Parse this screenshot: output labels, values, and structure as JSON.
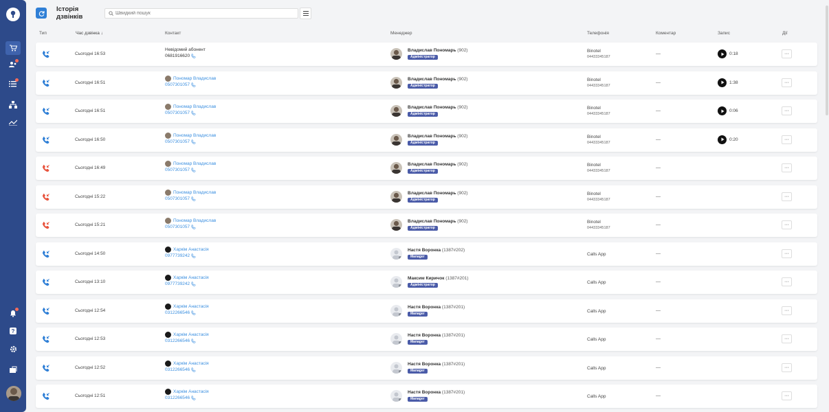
{
  "colors": {
    "accent": "#2f7fd6",
    "sidebar": "#2d4a8a",
    "incoming": "#2f7fd6",
    "missed": "#e8543e",
    "link": "#3b8fe0",
    "role_badge": "#4a5ba8"
  },
  "header": {
    "title": "Історія дзвінків",
    "search_placeholder": "Швидкий пошук"
  },
  "sidebar": {
    "icons": [
      "cart-icon",
      "users-icon",
      "tasks-icon",
      "structure-icon",
      "analytics-icon",
      "notifications-icon",
      "help-icon",
      "settings-icon",
      "exit-icon"
    ]
  },
  "columns": {
    "type": "Тип",
    "time": "Час дзвінка ↓",
    "contact": "Контакт",
    "manager": "Менеджер",
    "telephony": "Телефонія",
    "comment": "Коментар",
    "record": "Запис",
    "actions": "Дії"
  },
  "rows": [
    {
      "status": "incoming",
      "time": "Сьогодні 16:53",
      "contact_name": "Невідомий абонент",
      "contact_known": false,
      "contact_avatar": "none",
      "contact_phone": "0681916620",
      "manager": "Владислав Пономарь",
      "manager_ext": "(902)",
      "role": "Адміністратор",
      "manager_avatar": "photo",
      "telephony": "Binotel",
      "tel_number": "04433345187",
      "comment": "—",
      "record": "0:18"
    },
    {
      "status": "incoming",
      "time": "Сьогодні 16:51",
      "contact_name": "Пономар Владислав",
      "contact_known": true,
      "contact_avatar": "photo",
      "contact_phone": "0507301057",
      "manager": "Владислав Пономарь",
      "manager_ext": "(902)",
      "role": "Адміністратор",
      "manager_avatar": "photo",
      "telephony": "Binotel",
      "tel_number": "04433345187",
      "comment": "—",
      "record": "1:38"
    },
    {
      "status": "incoming",
      "time": "Сьогодні 16:51",
      "contact_name": "Пономар Владислав",
      "contact_known": true,
      "contact_avatar": "photo",
      "contact_phone": "0507301057",
      "manager": "Владислав Пономарь",
      "manager_ext": "(902)",
      "role": "Адміністратор",
      "manager_avatar": "photo",
      "telephony": "Binotel",
      "tel_number": "04433345187",
      "comment": "—",
      "record": "0:06"
    },
    {
      "status": "incoming",
      "time": "Сьогодні 16:50",
      "contact_name": "Пономар Владислав",
      "contact_known": true,
      "contact_avatar": "photo",
      "contact_phone": "0507301057",
      "manager": "Владислав Пономарь",
      "manager_ext": "(902)",
      "role": "Адміністратор",
      "manager_avatar": "photo",
      "telephony": "Binotel",
      "tel_number": "04433345187",
      "comment": "—",
      "record": "0:20"
    },
    {
      "status": "missed",
      "time": "Сьогодні 16:49",
      "contact_name": "Пономар Владислав",
      "contact_known": true,
      "contact_avatar": "photo",
      "contact_phone": "0507301057",
      "manager": "Владислав Пономарь",
      "manager_ext": "(902)",
      "role": "Адміністратор",
      "manager_avatar": "photo",
      "telephony": "Binotel",
      "tel_number": "04433345187",
      "comment": "—",
      "record": ""
    },
    {
      "status": "missed",
      "time": "Сьогодні 15:22",
      "contact_name": "Пономар Владислав",
      "contact_known": true,
      "contact_avatar": "photo",
      "contact_phone": "0507301057",
      "manager": "Владислав Пономарь",
      "manager_ext": "(902)",
      "role": "Адміністратор",
      "manager_avatar": "photo",
      "telephony": "Binotel",
      "tel_number": "04433345187",
      "comment": "—",
      "record": ""
    },
    {
      "status": "missed",
      "time": "Сьогодні 15:21",
      "contact_name": "Пономар Владислав",
      "contact_known": true,
      "contact_avatar": "photo",
      "contact_phone": "0507301057",
      "manager": "Владислав Пономарь",
      "manager_ext": "(902)",
      "role": "Адміністратор",
      "manager_avatar": "photo",
      "telephony": "Binotel",
      "tel_number": "04433345187",
      "comment": "—",
      "record": ""
    },
    {
      "status": "incoming",
      "time": "Сьогодні 14:50",
      "contact_name": "Харкім Анастасія",
      "contact_known": true,
      "contact_avatar": "dark",
      "contact_phone": "0977739242",
      "manager": "Настя Воронка",
      "manager_ext": "(1387#202)",
      "role": "Manager",
      "manager_avatar": "placeholder",
      "telephony": "Calls App",
      "tel_number": "",
      "comment": "—",
      "record": ""
    },
    {
      "status": "incoming",
      "time": "Сьогодні 13:10",
      "contact_name": "Харкім Анастасія",
      "contact_known": true,
      "contact_avatar": "dark",
      "contact_phone": "0977739242",
      "manager": "Максим Киричок",
      "manager_ext": "(1387#201)",
      "role": "Адміністратор",
      "manager_avatar": "placeholder",
      "telephony": "Calls App",
      "tel_number": "",
      "comment": "—",
      "record": ""
    },
    {
      "status": "incoming",
      "time": "Сьогодні 12:54",
      "contact_name": "Харкім Анастасія",
      "contact_known": true,
      "contact_avatar": "dark",
      "contact_phone": "0312266546",
      "manager": "Настя Воронка",
      "manager_ext": "(1387#201)",
      "role": "Manager",
      "manager_avatar": "placeholder",
      "telephony": "Calls App",
      "tel_number": "",
      "comment": "—",
      "record": ""
    },
    {
      "status": "incoming",
      "time": "Сьогодні 12:53",
      "contact_name": "Харкім Анастасія",
      "contact_known": true,
      "contact_avatar": "dark",
      "contact_phone": "0312266546",
      "manager": "Настя Воронка",
      "manager_ext": "(1387#201)",
      "role": "Manager",
      "manager_avatar": "placeholder",
      "telephony": "Calls App",
      "tel_number": "",
      "comment": "—",
      "record": ""
    },
    {
      "status": "incoming",
      "time": "Сьогодні 12:52",
      "contact_name": "Харкім Анастасія",
      "contact_known": true,
      "contact_avatar": "dark",
      "contact_phone": "0312266546",
      "manager": "Настя Воронка",
      "manager_ext": "(1387#201)",
      "role": "Manager",
      "manager_avatar": "placeholder",
      "telephony": "Calls App",
      "tel_number": "",
      "comment": "—",
      "record": ""
    },
    {
      "status": "incoming",
      "time": "Сьогодні 12:51",
      "contact_name": "Харкім Анастасія",
      "contact_known": true,
      "contact_avatar": "dark",
      "contact_phone": "0312266546",
      "manager": "Настя Воронка",
      "manager_ext": "(1387#201)",
      "role": "Manager",
      "manager_avatar": "placeholder",
      "telephony": "Calls App",
      "tel_number": "",
      "comment": "—",
      "record": ""
    }
  ]
}
